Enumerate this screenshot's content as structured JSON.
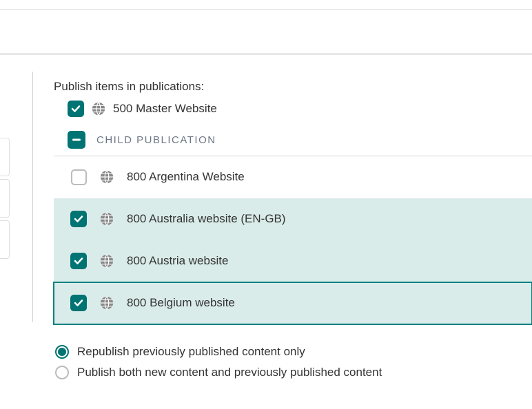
{
  "heading": "Publish items in publications:",
  "master": {
    "checked": true,
    "label": "500 Master Website"
  },
  "section_label": "CHILD PUBLICATION",
  "children": [
    {
      "checked": false,
      "label": "800 Argentina Website",
      "state": "none"
    },
    {
      "checked": true,
      "label": "800 Australia website (EN-GB)",
      "state": "selected"
    },
    {
      "checked": true,
      "label": "800 Austria website",
      "state": "selected"
    },
    {
      "checked": true,
      "label": "800 Belgium website",
      "state": "active"
    }
  ],
  "radios": {
    "option1": "Republish previously published content only",
    "option2": "Publish both new content and previously published content",
    "selected": 0
  }
}
